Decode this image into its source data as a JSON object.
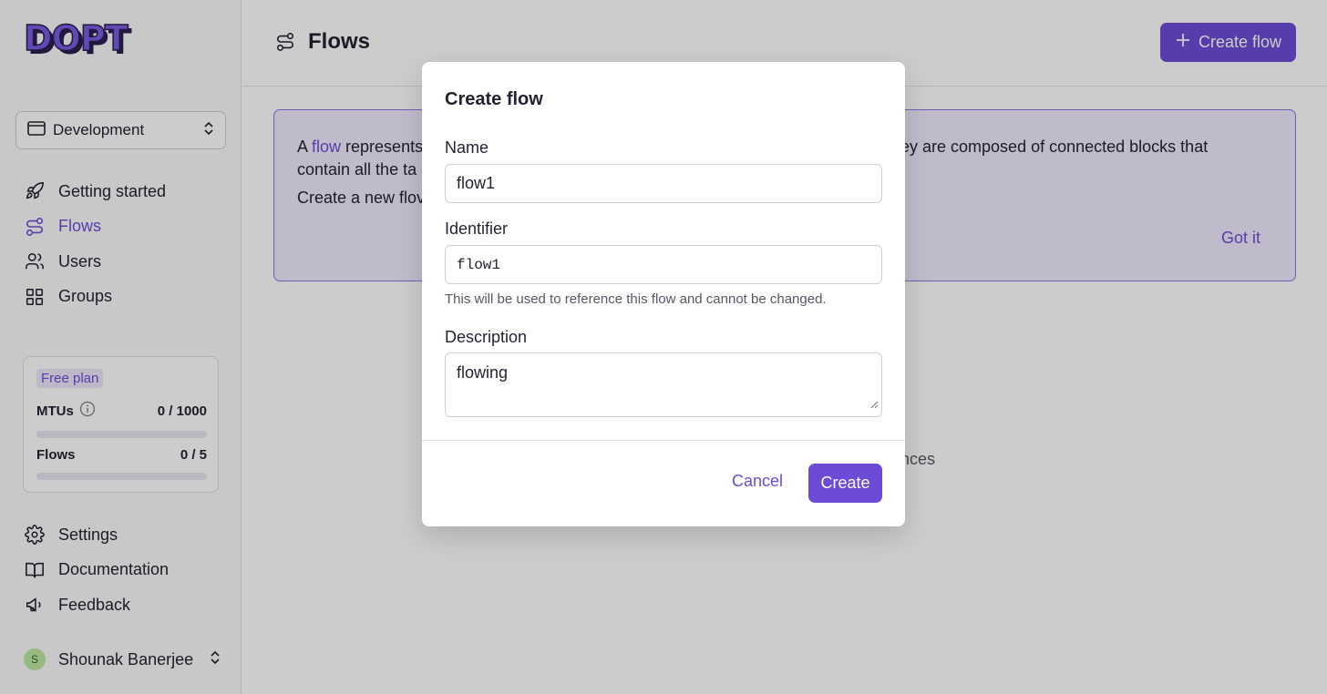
{
  "brand": {
    "logo_text": "DOPT",
    "accent": "#6d4bd6"
  },
  "sidebar": {
    "environment": "Development",
    "nav": [
      {
        "label": "Getting started",
        "icon": "rocket-icon"
      },
      {
        "label": "Flows",
        "icon": "flows-icon",
        "active": true
      },
      {
        "label": "Users",
        "icon": "users-icon"
      },
      {
        "label": "Groups",
        "icon": "groups-icon"
      }
    ],
    "plan": {
      "badge": "Free plan",
      "mtus_label": "MTUs",
      "mtus_value": "0 / 1000",
      "mtus_progress": 0,
      "flows_label": "Flows",
      "flows_value": "0 / 5",
      "flows_progress": 0
    },
    "nav_bottom": [
      {
        "label": "Settings",
        "icon": "gear-icon"
      },
      {
        "label": "Documentation",
        "icon": "book-icon"
      },
      {
        "label": "Feedback",
        "icon": "megaphone-icon"
      }
    ],
    "user": {
      "initial": "S",
      "name": "Shounak Banerjee"
    }
  },
  "header": {
    "title": "Flows",
    "create_button": "Create flow"
  },
  "banner": {
    "prefix": "A ",
    "link": "flow",
    "line1_visible": " represents",
    "line1_right": "ey are composed of connected blocks that",
    "line2": "contain all the ta",
    "line3": "Create a new flov",
    "got_it": "Got it"
  },
  "background_fragment": "nces",
  "modal": {
    "title": "Create flow",
    "name_label": "Name",
    "name_value": "flow1",
    "identifier_label": "Identifier",
    "identifier_value": "flow1",
    "identifier_hint": "This will be used to reference this flow and cannot be changed.",
    "description_label": "Description",
    "description_value": "flowing",
    "cancel": "Cancel",
    "create": "Create"
  }
}
